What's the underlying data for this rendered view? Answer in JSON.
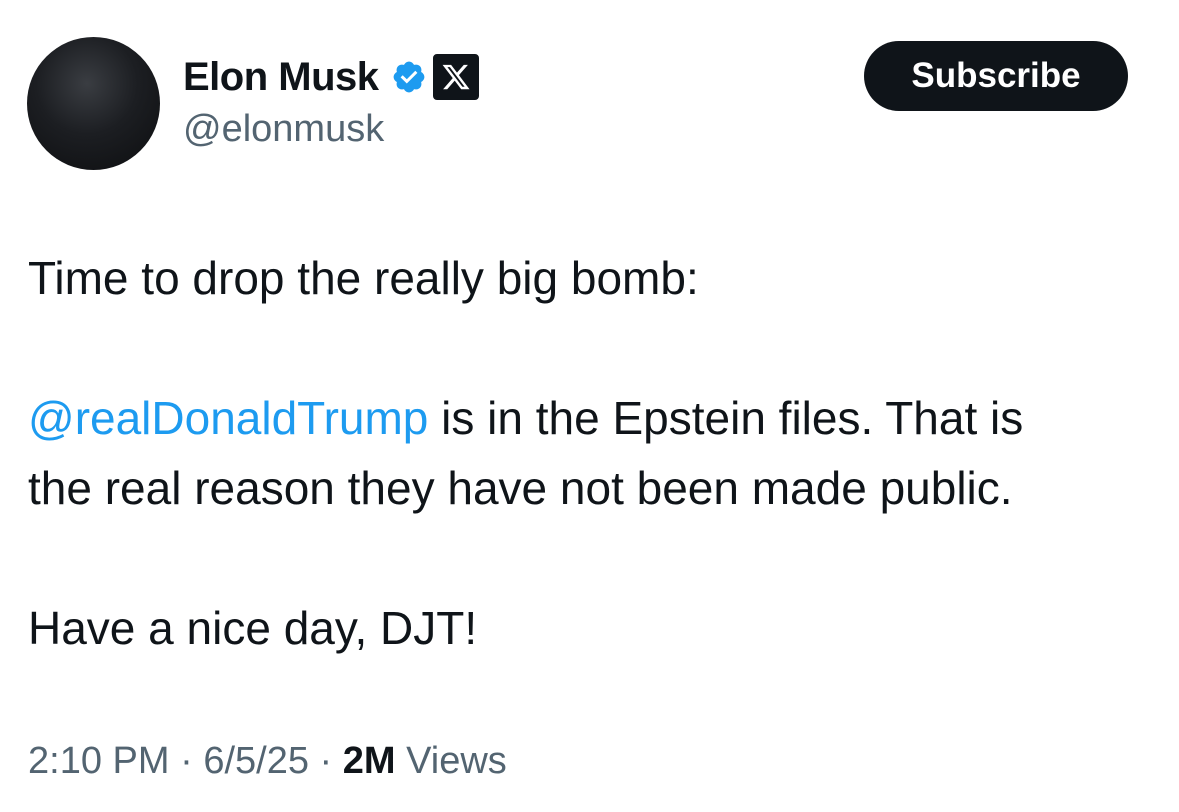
{
  "author": {
    "display_name": "Elon Musk",
    "handle": "@elonmusk",
    "verified_badge": "verified-badge-icon",
    "affiliation_badge": "x-logo-icon"
  },
  "subscribe_label": "Subscribe",
  "tweet": {
    "line1": "Time to drop the really big bomb:",
    "mention": "@realDonaldTrump",
    "line2_rest": " is in the Epstein files. That is",
    "line3": "the real reason they have not been made public.",
    "line4": "Have a nice day, DJT!"
  },
  "meta": {
    "time": "2:10 PM",
    "separator": " · ",
    "date": "6/5/25",
    "views_count": "2M",
    "views_label": " Views"
  },
  "colors": {
    "text": "#0f1419",
    "secondary": "#536471",
    "link": "#1d9bf0",
    "verified": "#1d9bf0",
    "button": "#0f1419"
  }
}
